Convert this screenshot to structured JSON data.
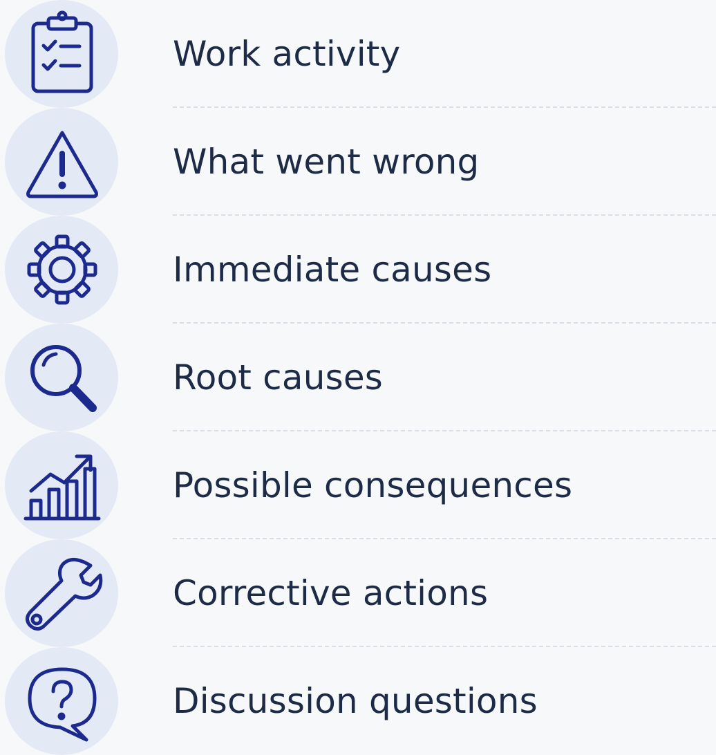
{
  "colors": {
    "background": "#f7f8fa",
    "icon_circle": "#e4e9f6",
    "icon_stroke": "#1c2a8e",
    "text": "#1d2b47",
    "divider": "#d9dde5"
  },
  "items": [
    {
      "label": "Work activity",
      "icon": "clipboard-checklist-icon"
    },
    {
      "label": "What went wrong",
      "icon": "warning-triangle-icon"
    },
    {
      "label": "Immediate causes",
      "icon": "gear-icon"
    },
    {
      "label": "Root causes",
      "icon": "magnifying-glass-icon"
    },
    {
      "label": "Possible consequences",
      "icon": "chart-trend-up-icon"
    },
    {
      "label": "Corrective actions",
      "icon": "wrench-icon"
    },
    {
      "label": "Discussion questions",
      "icon": "question-speech-bubble-icon"
    }
  ]
}
